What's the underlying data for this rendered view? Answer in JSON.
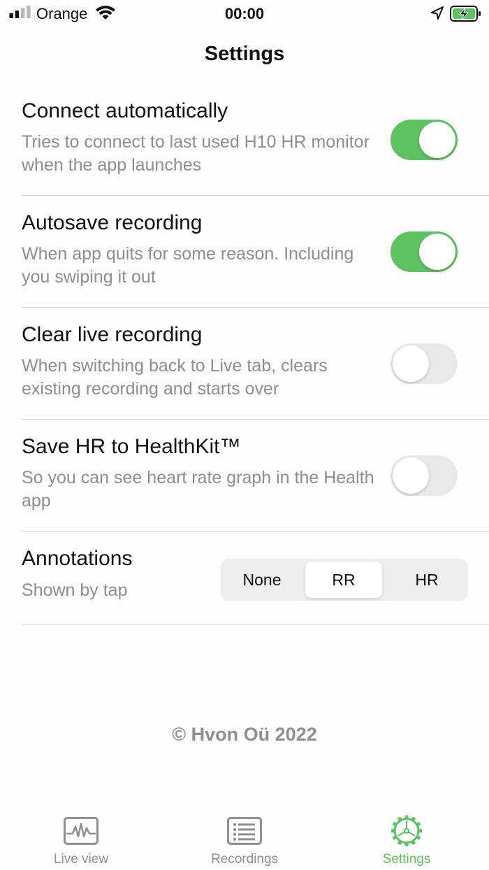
{
  "status_bar": {
    "carrier": "Orange",
    "time": "00:00",
    "icons": [
      "signal-icon",
      "wifi-icon",
      "location-icon",
      "battery-charging-icon"
    ]
  },
  "header": {
    "title": "Settings"
  },
  "settings": [
    {
      "title": "Connect automatically",
      "subtitle": "Tries to connect to last used H10 HR monitor when the app launches",
      "enabled": true
    },
    {
      "title": "Autosave recording",
      "subtitle": "When app quits for some reason. Including you swiping it out",
      "enabled": true
    },
    {
      "title": "Clear live recording",
      "subtitle": "When switching back to Live tab, clears existing recording and starts over",
      "enabled": false
    },
    {
      "title": "Save HR to HealthKit™",
      "subtitle": "So you can see heart rate graph in the Health app",
      "enabled": false
    }
  ],
  "annotations": {
    "title": "Annotations",
    "subtitle": "Shown by tap",
    "options": [
      "None",
      "RR",
      "HR"
    ],
    "selected": "RR"
  },
  "footer": {
    "copyright": "© Hvon Oü 2022"
  },
  "tab_bar": {
    "tabs": [
      {
        "label": "Live view",
        "icon": "waveform-icon"
      },
      {
        "label": "Recordings",
        "icon": "list-icon"
      },
      {
        "label": "Settings",
        "icon": "gear-icon"
      }
    ],
    "active": "Settings"
  },
  "colors": {
    "accent": "#5dc25f",
    "toggle_off": "#e9e9ea",
    "secondary_text": "#8d8d92",
    "tab_inactive": "#8e8e93"
  }
}
